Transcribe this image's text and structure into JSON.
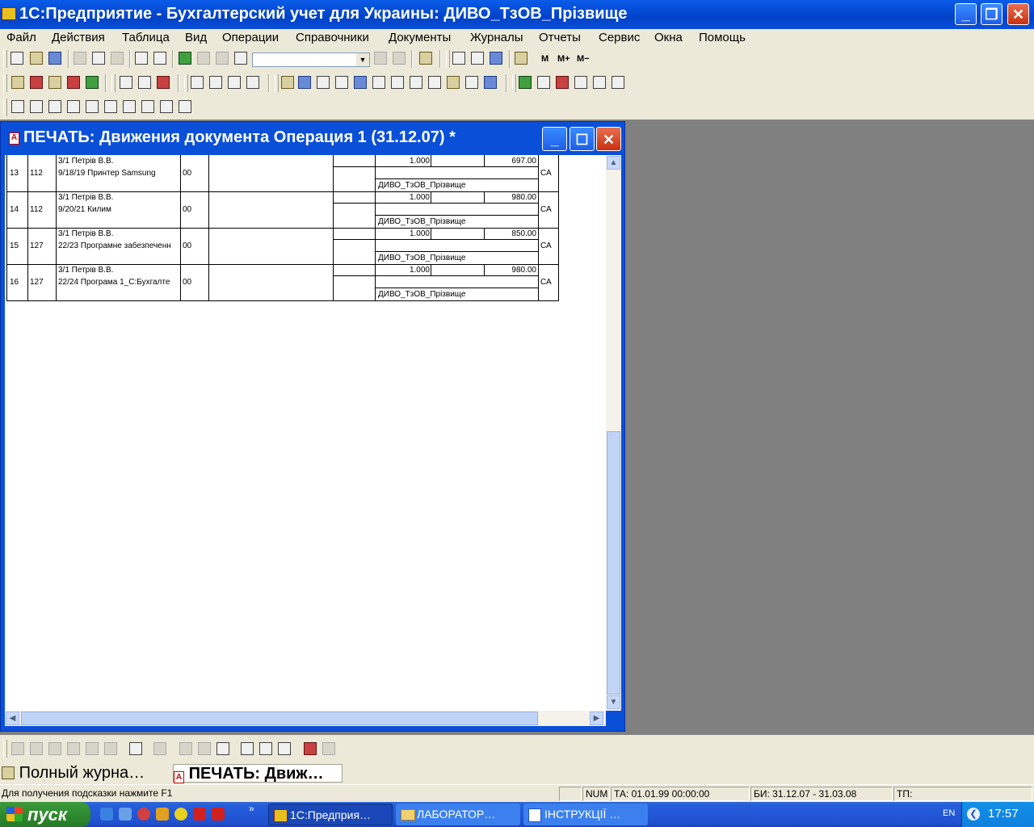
{
  "app": {
    "title": "1С:Предприятие - Бухгалтерский учет для Украины: ДИВО_ТзОВ_Прізвище",
    "minimize": "_",
    "restore": "❐",
    "close": "✕"
  },
  "menu": [
    "Файл",
    "Действия",
    "Таблица",
    "Вид",
    "Операции",
    "Справочники",
    "Документы",
    "Журналы",
    "Отчеты",
    "Сервис",
    "Окна",
    "Помощь"
  ],
  "toolbar": {
    "combo_value": "",
    "m_label": "M",
    "mplus_label": "M+",
    "mminus_label": "M−"
  },
  "child_window": {
    "title": "ПЕЧАТЬ: Движения документа Операция 1 (31.12.07)  *",
    "icon_letter": "A"
  },
  "table": {
    "rows": [
      {
        "num": "13",
        "acct": "112",
        "line1": "3/1 Петрів В.В.",
        "line2": "9/18/19 Принтер Samsung",
        "code": "00",
        "qty": "1.000",
        "sum": "697.00",
        "org": "ДИВО_ТзОВ_Прізвище",
        "tag": "СА"
      },
      {
        "num": "14",
        "acct": "112",
        "line1": "3/1 Петрів В.В.",
        "line2": "9/20/21 Килим",
        "code": "00",
        "qty": "1.000",
        "sum": "980.00",
        "org": "ДИВО_ТзОВ_Прізвище",
        "tag": "СА"
      },
      {
        "num": "15",
        "acct": "127",
        "line1": "3/1 Петрів В.В.",
        "line2": "22/23 Програмне забезпеченн",
        "code": "00",
        "qty": "1.000",
        "sum": "850.00",
        "org": "ДИВО_ТзОВ_Прізвище",
        "tag": "СА"
      },
      {
        "num": "16",
        "acct": "127",
        "line1": "3/1 Петрів В.В.",
        "line2": "22/24 Програма 1_С:Бухгалте",
        "code": "00",
        "qty": "1.000",
        "sum": "980.00",
        "org": "ДИВО_ТзОВ_Прізвище",
        "tag": "СА"
      }
    ]
  },
  "window_tabs": [
    {
      "label": "Полный журна…"
    },
    {
      "label": "ПЕЧАТЬ: Движ…"
    }
  ],
  "status": {
    "hint": "Для получения подсказки нажмите F1",
    "num": "NUM",
    "ta": "ТА: 01.01.99  00:00:00",
    "bi": "БИ: 31.12.07 - 31.03.08",
    "tp": "ТП:"
  },
  "taskbar": {
    "start": "пуск",
    "tasks": [
      "1С:Предприя…",
      "ЛАБОРАТОР…",
      "ІНСТРУКЦІЇ …"
    ],
    "lang": "EN",
    "clock": "17:57",
    "more": "»"
  },
  "colors": {
    "xp_blue": "#0a4fd8",
    "face": "#ece9d8",
    "mdi_bg": "#808080"
  }
}
